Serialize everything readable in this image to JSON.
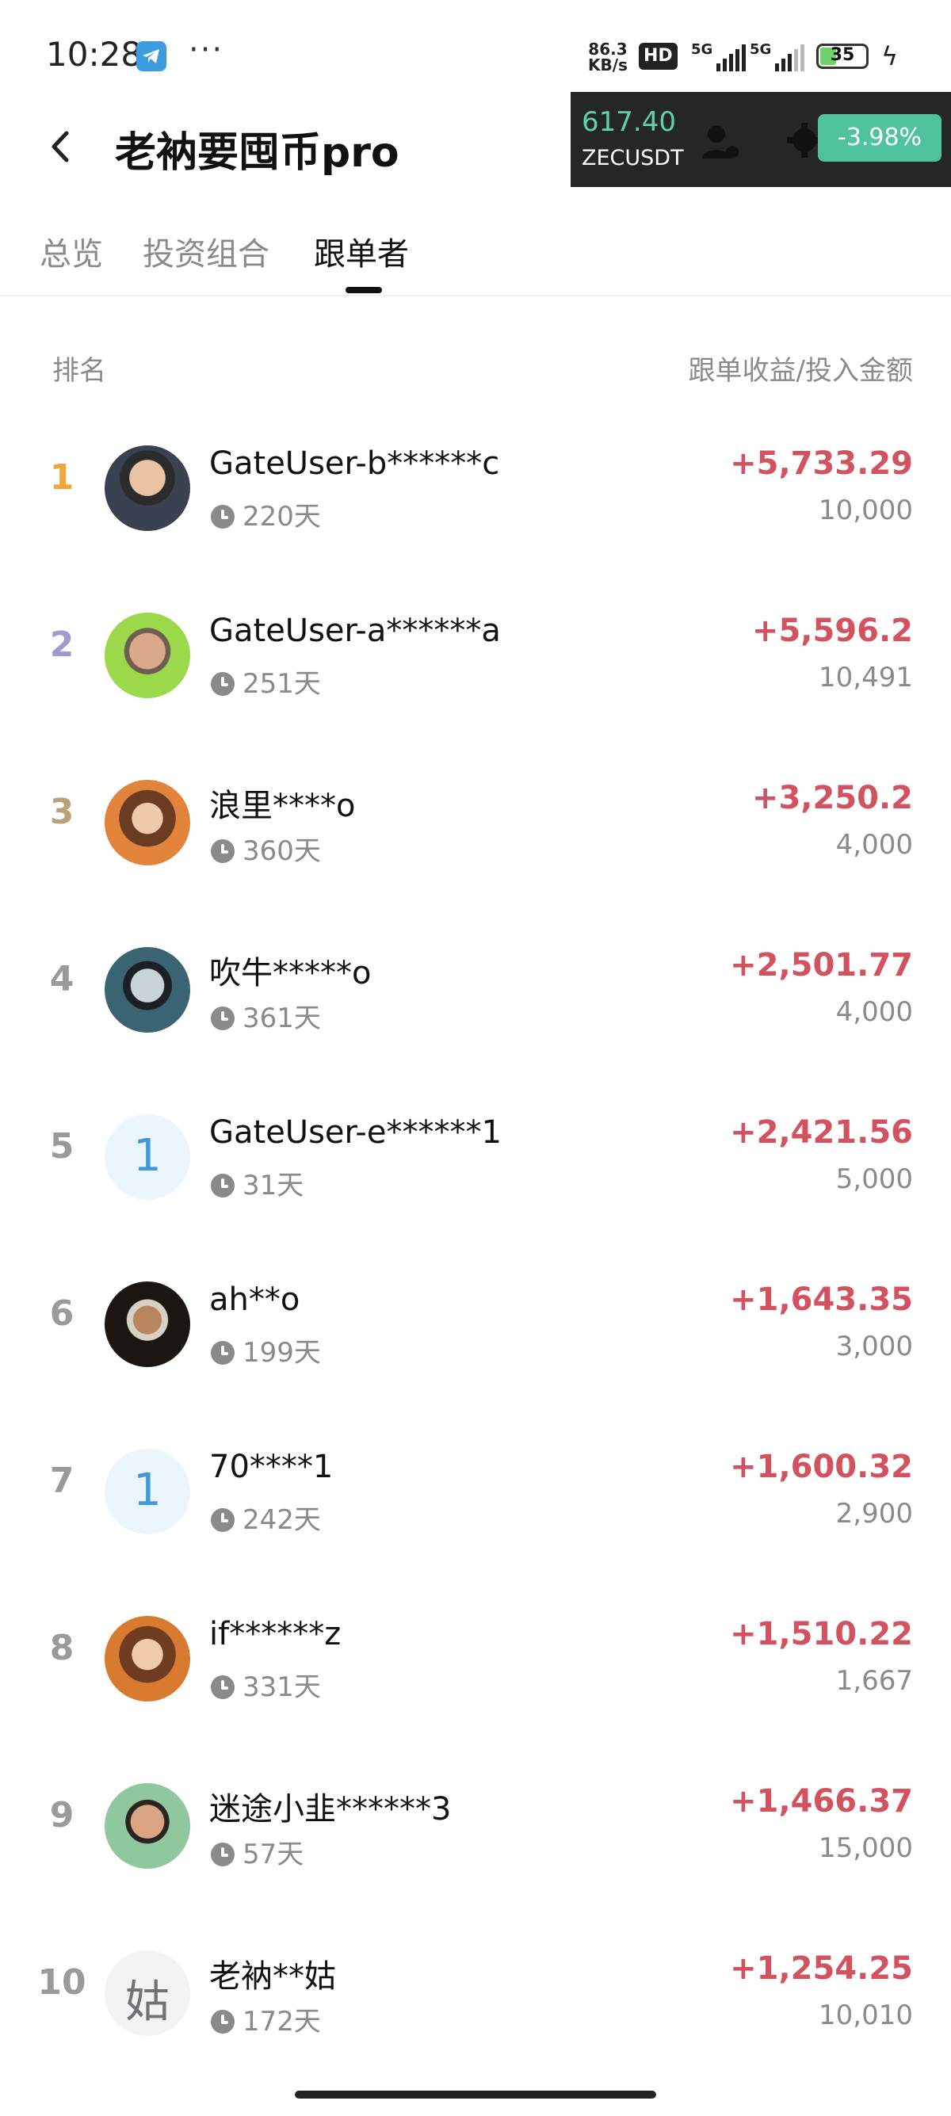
{
  "status_bar": {
    "time": "10:28",
    "more": "···",
    "net_speed_value": "86.3",
    "net_speed_unit": "KB/s",
    "hd_badge": "HD",
    "signal_1": "5G",
    "signal_2": "5G",
    "battery_level": "35",
    "battery_fraction": 0.35
  },
  "header": {
    "title": "老衲要囤币pro"
  },
  "ticker": {
    "price": "617.40",
    "symbol": "ZECUSDT",
    "change": "-3.98%",
    "price_color": "#5ed4a6",
    "change_color": "#4fc29e"
  },
  "tabs": [
    {
      "label": "总览"
    },
    {
      "label": "投资组合"
    },
    {
      "label": "跟单者"
    }
  ],
  "list_header": {
    "rank": "排名",
    "profit": "跟单收益/投入金额"
  },
  "colors": {
    "profit": "#d2535f",
    "rank_1": "#f0a63a",
    "rank_2": "#9d9ccf",
    "rank_3": "#b9a27a",
    "rank_default": "#9a9a9a"
  },
  "followers": [
    {
      "rank": "1",
      "name": "GateUser-b******c",
      "days": "220天",
      "profit": "+5,733.29",
      "amount": "10,000"
    },
    {
      "rank": "2",
      "name": "GateUser-a******a",
      "days": "251天",
      "profit": "+5,596.2",
      "amount": "10,491"
    },
    {
      "rank": "3",
      "name": "浪里****o",
      "days": "360天",
      "profit": "+3,250.2",
      "amount": "4,000"
    },
    {
      "rank": "4",
      "name": "吹牛*****o",
      "days": "361天",
      "profit": "+2,501.77",
      "amount": "4,000"
    },
    {
      "rank": "5",
      "name": "GateUser-e******1",
      "days": "31天",
      "profit": "+2,421.56",
      "amount": "5,000",
      "avatar_letter": "1"
    },
    {
      "rank": "6",
      "name": "ah**o",
      "days": "199天",
      "profit": "+1,643.35",
      "amount": "3,000"
    },
    {
      "rank": "7",
      "name": "70****1",
      "days": "242天",
      "profit": "+1,600.32",
      "amount": "2,900",
      "avatar_letter": "1"
    },
    {
      "rank": "8",
      "name": "if******z",
      "days": "331天",
      "profit": "+1,510.22",
      "amount": "1,667"
    },
    {
      "rank": "9",
      "name": "迷途小韭******3",
      "days": "57天",
      "profit": "+1,466.37",
      "amount": "15,000"
    },
    {
      "rank": "10",
      "name": "老衲**姑",
      "days": "172天",
      "profit": "+1,254.25",
      "amount": "10,010",
      "avatar_letter": "姑"
    }
  ]
}
